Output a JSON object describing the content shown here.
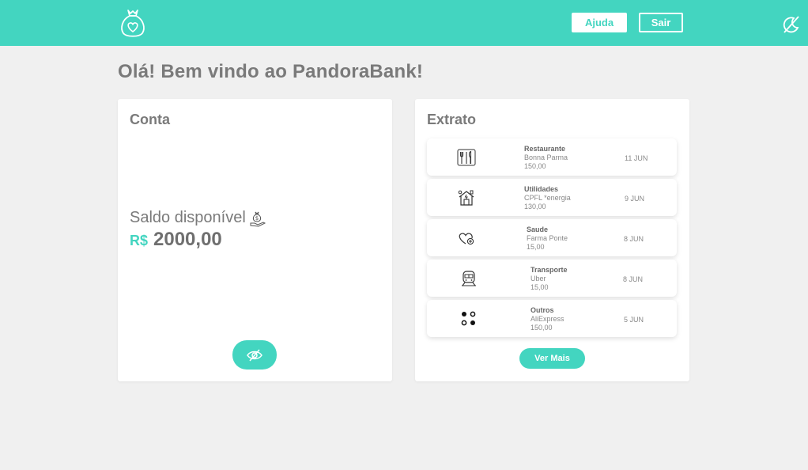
{
  "header": {
    "logo_icon": "money-bag-heart-icon",
    "help_label": "Ajuda",
    "logout_label": "Sair",
    "theme_icon": "moon-slash-icon",
    "accent_color": "#43d5c0"
  },
  "page_title": "Olá! Bem vindo ao PandoraBank!",
  "account": {
    "title": "Conta",
    "balance_label": "Saldo disponível",
    "balance_icon": "money-hand-icon",
    "currency": "R$",
    "balance": "2000,00",
    "toggle_icon": "eye-slash-icon"
  },
  "statement": {
    "title": "Extrato",
    "items": [
      {
        "icon": "fork-knife-icon",
        "category": "Restaurante",
        "description": "Bonna Parma",
        "amount": "150,00",
        "date": "11 JUN"
      },
      {
        "icon": "house-energy-icon",
        "category": "Utilidades",
        "description": "CPFL *energia",
        "amount": "130,00",
        "date": "9 JUN"
      },
      {
        "icon": "heart-health-icon",
        "category": "Saude",
        "description": "Farma Ponte",
        "amount": "15,00",
        "date": "8 JUN"
      },
      {
        "icon": "train-icon",
        "category": "Transporte",
        "description": "Uber",
        "amount": "15,00",
        "date": "8 JUN"
      },
      {
        "icon": "four-dots-icon",
        "category": "Outros",
        "description": "AliExpress",
        "amount": "150,00",
        "date": "5 JUN"
      }
    ],
    "more_label": "Ver Mais"
  }
}
